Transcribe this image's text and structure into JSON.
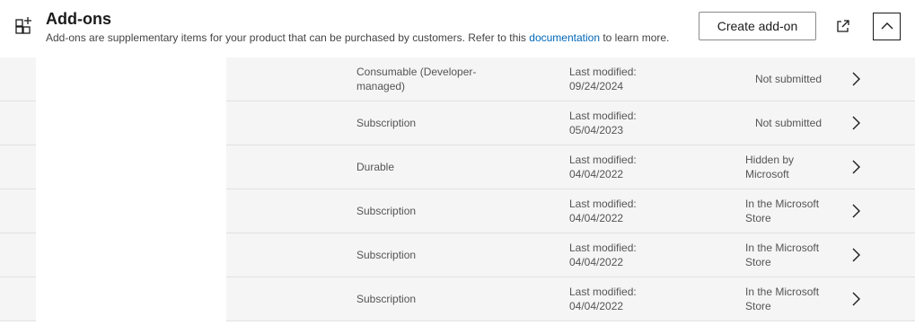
{
  "header": {
    "title": "Add-ons",
    "description_prefix": "Add-ons are supplementary items for your product that can be purchased by customers. Refer to this ",
    "description_link": "documentation",
    "description_suffix": " to learn more.",
    "create_button": "Create add-on"
  },
  "rows": [
    {
      "type": "Consumable (Developer-managed)",
      "modified_label": "Last modified:",
      "modified_date": "09/24/2024",
      "status": "Not submitted"
    },
    {
      "type": "Subscription",
      "modified_label": "Last modified:",
      "modified_date": "05/04/2023",
      "status": "Not submitted"
    },
    {
      "type": "Durable",
      "modified_label": "Last modified:",
      "modified_date": "04/04/2022",
      "status": "Hidden by Microsoft"
    },
    {
      "type": "Subscription",
      "modified_label": "Last modified:",
      "modified_date": "04/04/2022",
      "status": "In the Microsoft Store"
    },
    {
      "type": "Subscription",
      "modified_label": "Last modified:",
      "modified_date": "04/04/2022",
      "status": "In the Microsoft Store"
    },
    {
      "type": "Subscription",
      "modified_label": "Last modified:",
      "modified_date": "04/04/2022",
      "status": "In the Microsoft Store"
    }
  ]
}
